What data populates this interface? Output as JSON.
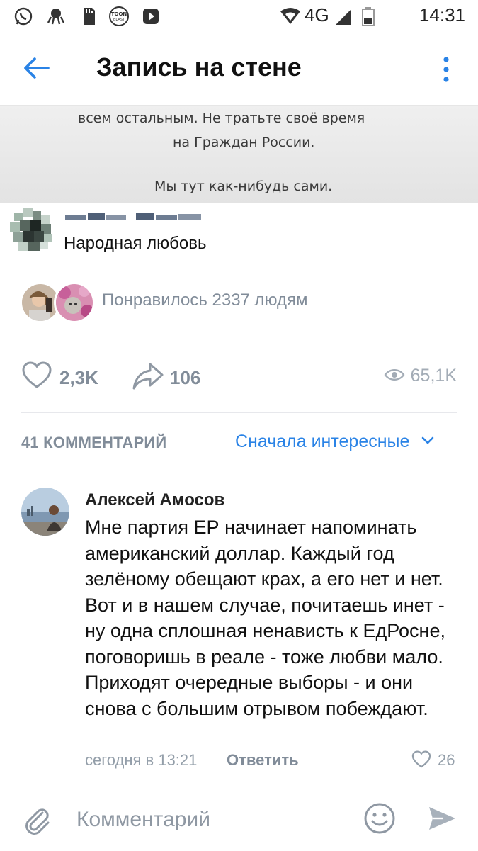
{
  "status_bar": {
    "time": "14:31",
    "network": "4G",
    "icons": [
      "whatsapp-icon",
      "octopus-icon",
      "sd-card-icon",
      "toon-blast-icon",
      "app-icon",
      "wifi-icon",
      "signal-icon",
      "battery-icon"
    ]
  },
  "header": {
    "title": "Запись на стене",
    "back_icon": "arrow-left-icon",
    "more_icon": "vertical-dots-icon",
    "accent": "#2a83e6"
  },
  "post": {
    "image_lines": [
      "всем остальным. Не тратьте своё время",
      "на Граждан России.",
      "Мы тут как-нибудь сами."
    ],
    "text": "Народная любовь",
    "liked_by": "Понравилось 2337 людям",
    "likes": "2,3K",
    "shares": "106",
    "views": "65,1K"
  },
  "comments": {
    "count_label": "41 КОММЕНТАРИЙ",
    "sort_label": "Сначала интересные",
    "items": [
      {
        "author": "Алексей Амосов",
        "text": "Мне партия ЕР начинает напоминать американский доллар. Каждый год зелёному обещают крах, а его нет и нет. Вот и в нашем случае, почитаешь инет - ну одна сплошная ненависть к ЕдРосне, поговоришь в реале - тоже любви мало. Приходят очередные выборы - и они снова с большим отрывом побеждают.",
        "time": "сегодня в 13:21",
        "reply_label": "Ответить",
        "likes": "26"
      }
    ]
  },
  "composer": {
    "placeholder": "Комментарий"
  }
}
